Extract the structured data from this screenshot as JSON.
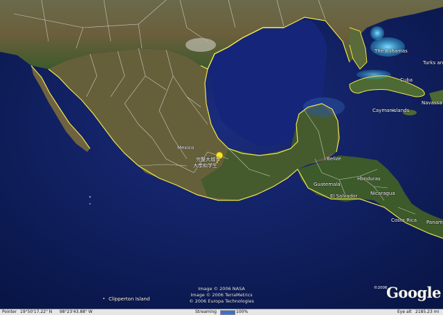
{
  "labels": {
    "the_bahamas": "The Bahamas",
    "turks_and": "Turks and",
    "cuba": "Cuba",
    "cayman_islands": "Caymanislands",
    "navassa": "Navassa",
    "mexico": "Mexico",
    "poi_1": "完整大城市",
    "poi_2": "大學和学生",
    "belize": "Belize",
    "honduras": "Honduras",
    "guatemala": "Guatemala",
    "el_salvador": "El Salvador",
    "nicaragua": "Nicaragua",
    "costa_rica": "Costa Rica",
    "panama": "Panama",
    "clipperton": "Clipperton Island"
  },
  "credits": [
    "Image © 2006 NASA",
    "Image © 2006 TerraMetrics",
    "© 2006 Europa Technologies"
  ],
  "logo": {
    "copyright": "©2006",
    "word": "Google"
  },
  "statusbar": {
    "pointer_label": "Pointer",
    "lat": "19°50'17.22\" N",
    "lon": "98°23'43.88\" W",
    "streaming_label": "Streaming",
    "streaming_value": "100%",
    "streaming_fraction": 1.0,
    "eye_alt_label": "Eye alt",
    "eye_alt_value": "2185.23 mi"
  },
  "colors": {
    "ocean": "#0c1a5a",
    "land": "#5c5a36",
    "coast": "#f2e64a",
    "border": "#e6e6e6"
  }
}
